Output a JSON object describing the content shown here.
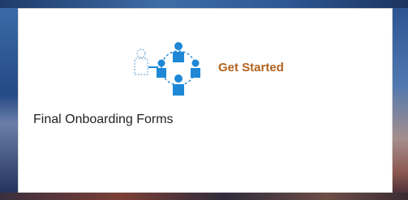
{
  "tile": {
    "action_label": "Get Started",
    "title": "Final Onboarding Forms",
    "icon": "people-network-icon"
  },
  "colors": {
    "action": "#b3621f",
    "icon_blue": "#1e88d6",
    "icon_dashed": "#8bb8dc"
  }
}
